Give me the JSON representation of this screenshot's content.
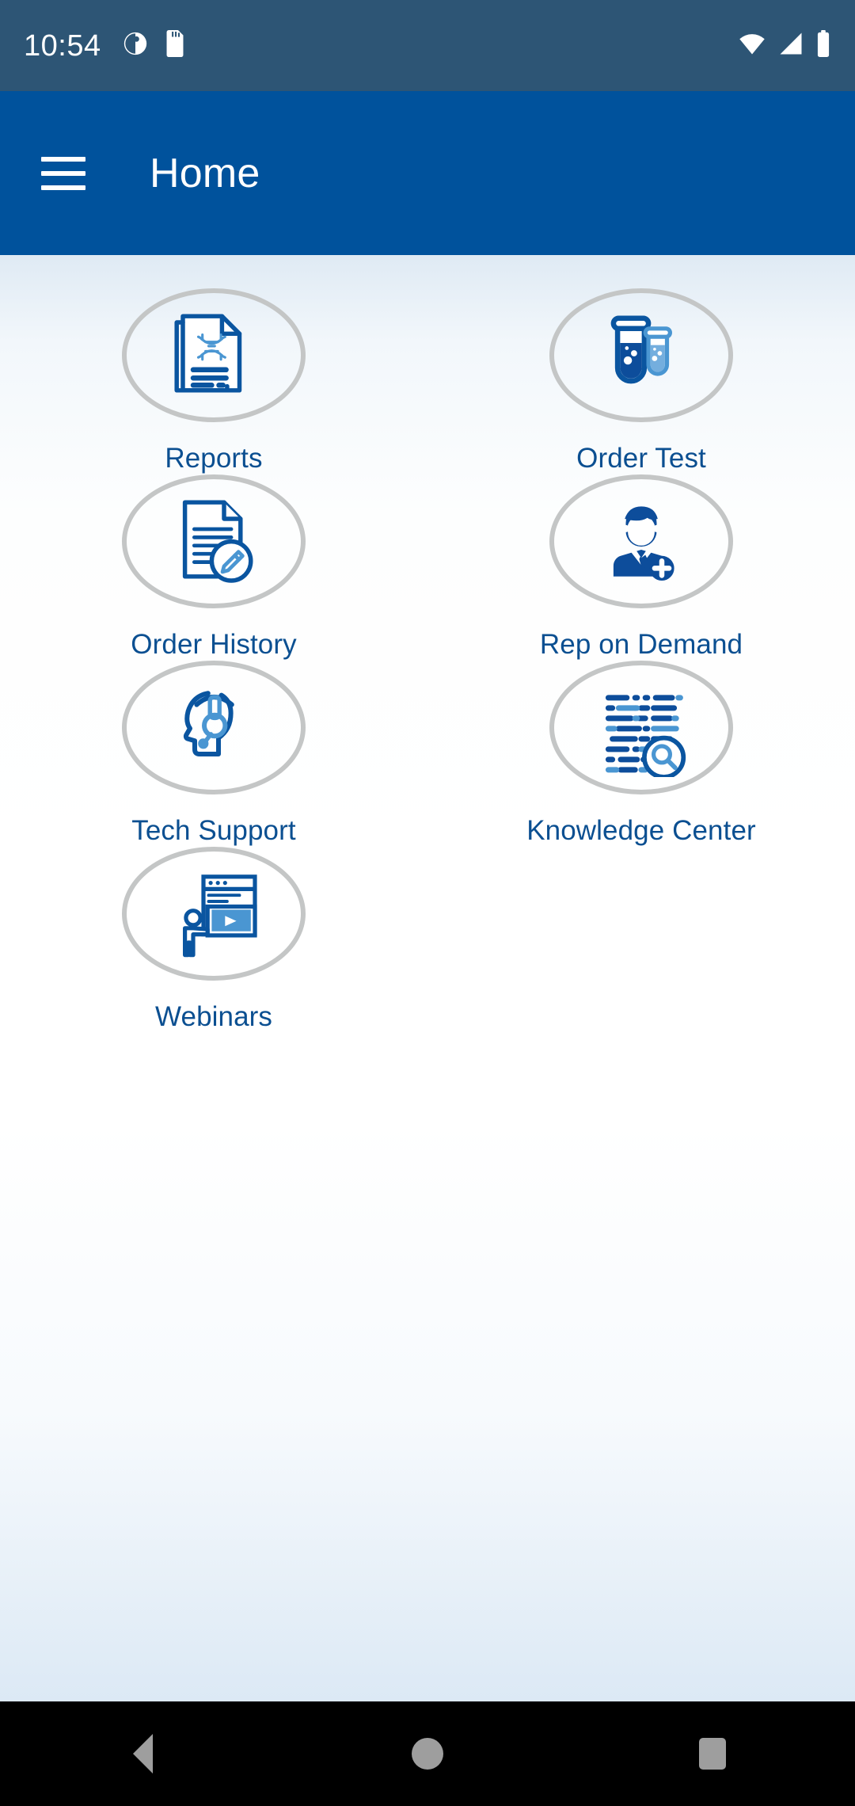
{
  "status_bar": {
    "time": "10:54",
    "left_icons": [
      "app-notification-icon",
      "sd-card-icon"
    ],
    "right_icons": [
      "wifi-icon",
      "cellular-signal-icon",
      "battery-icon"
    ],
    "background_color": "#2d5575",
    "foreground_color": "#ffffff"
  },
  "app_bar": {
    "title": "Home",
    "menu_icon": "hamburger-menu-icon",
    "background_color": "#00529c",
    "text_color": "#ffffff"
  },
  "theme": {
    "accent_blue": "#00529c",
    "label_blue": "#0b4f91",
    "icon_dark_blue": "#0a55a0",
    "icon_light_blue": "#4a96d2",
    "circle_border": "#c4c6c6",
    "content_background": "#ffffff"
  },
  "home_grid": {
    "tiles": [
      {
        "label": "Reports",
        "icon": "report-document-dna-icon"
      },
      {
        "label": "Order Test",
        "icon": "test-tubes-icon"
      },
      {
        "label": "Order History",
        "icon": "document-pencil-icon"
      },
      {
        "label": "Rep on Demand",
        "icon": "sales-rep-person-plus-icon"
      },
      {
        "label": "Tech Support",
        "icon": "headset-head-icon"
      },
      {
        "label": "Knowledge Center",
        "icon": "text-lines-magnifier-icon"
      },
      {
        "label": "Webinars",
        "icon": "presenter-video-screen-icon"
      }
    ]
  },
  "nav_bar": {
    "buttons": [
      {
        "name": "back",
        "icon": "back-triangle-icon"
      },
      {
        "name": "home",
        "icon": "home-circle-icon"
      },
      {
        "name": "recents",
        "icon": "recents-square-icon"
      }
    ],
    "background_color": "#000000"
  }
}
